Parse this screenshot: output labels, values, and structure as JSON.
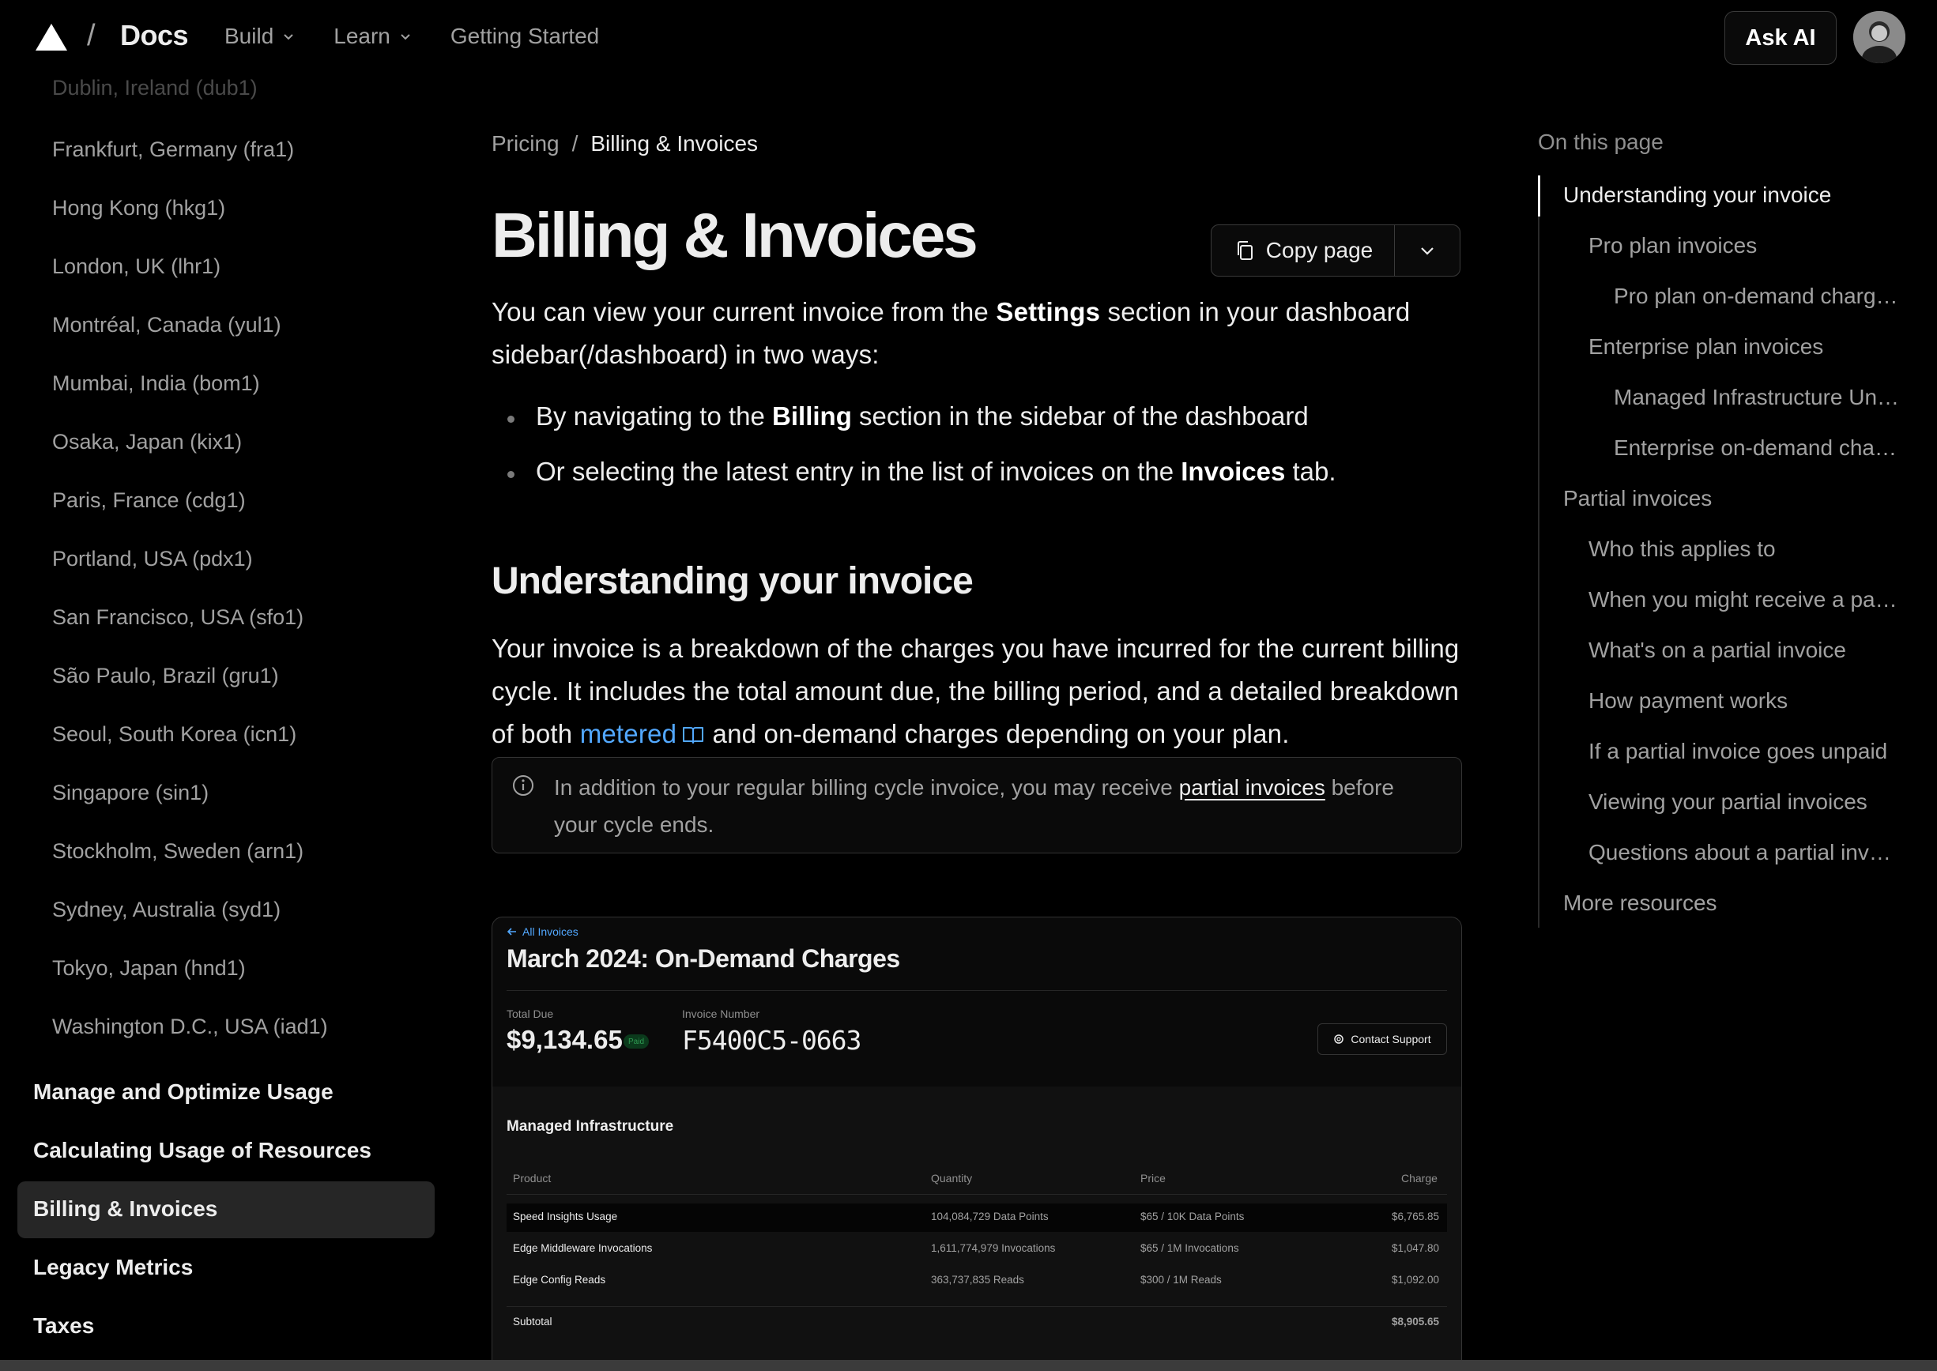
{
  "header": {
    "docs_title": "Docs",
    "separator": "/",
    "nav": [
      {
        "label": "Build",
        "has_menu": true
      },
      {
        "label": "Learn",
        "has_menu": true
      },
      {
        "label": "Getting Started",
        "has_menu": false
      }
    ],
    "ask_ai_label": "Ask AI"
  },
  "sidebar": {
    "regions": [
      "Dublin, Ireland (dub1)",
      "Frankfurt, Germany (fra1)",
      "Hong Kong (hkg1)",
      "London, UK (lhr1)",
      "Montréal, Canada (yul1)",
      "Mumbai, India (bom1)",
      "Osaka, Japan (kix1)",
      "Paris, France (cdg1)",
      "Portland, USA (pdx1)",
      "San Francisco, USA (sfo1)",
      "São Paulo, Brazil (gru1)",
      "Seoul, South Korea (icn1)",
      "Singapore (sin1)",
      "Stockholm, Sweden (arn1)",
      "Sydney, Australia (syd1)",
      "Tokyo, Japan (hnd1)",
      "Washington D.C., USA (iad1)"
    ],
    "sections": [
      "Manage and Optimize Usage",
      "Calculating Usage of Resources",
      "Billing & Invoices",
      "Legacy Metrics",
      "Taxes"
    ],
    "active_section": "Billing & Invoices"
  },
  "main": {
    "breadcrumb": {
      "parent": "Pricing",
      "separator": "/",
      "current": "Billing & Invoices"
    },
    "title": "Billing & Invoices",
    "copy_page_label": "Copy page",
    "intro": {
      "before": "You can view your current invoice from the ",
      "bold": "Settings",
      "after": " section in your dashboard sidebar(/dashboard) in two ways:"
    },
    "bullets": [
      {
        "before": "By navigating to the ",
        "bold": "Billing",
        "after": " section in the sidebar of the dashboard"
      },
      {
        "before": "Or selecting the latest entry in the list of invoices on the ",
        "bold": "Invoices",
        "after": " tab."
      }
    ],
    "section_heading": "Understanding your invoice",
    "paragraph": {
      "before": "Your invoice is a breakdown of the charges you have incurred for the current billing cycle. It includes the total amount due, the billing period, and a detailed breakdown of both ",
      "link": "metered",
      "after": " and on-demand charges depending on your plan."
    },
    "note": {
      "before": "In addition to your regular billing cycle invoice, you may receive ",
      "link": "partial invoices",
      "after": " before your cycle ends."
    },
    "invoice_image": {
      "back_label": "All Invoices",
      "title": "March 2024: On-Demand Charges",
      "total_due_label": "Total Due",
      "total_due": "$9,134.65",
      "status_badge": "Paid",
      "invoice_number_label": "Invoice Number",
      "invoice_number": "F5400C5-0663",
      "contact_support": "Contact Support",
      "section": "Managed Infrastructure",
      "columns": [
        "Product",
        "Quantity",
        "Price",
        "Charge"
      ],
      "rows": [
        {
          "product": "Speed Insights Usage",
          "quantity": "104,084,729 Data Points",
          "price": "$65 / 10K Data Points",
          "charge": "$6,765.85"
        },
        {
          "product": "Edge Middleware Invocations",
          "quantity": "1,611,774,979 Invocations",
          "price": "$65 / 1M Invocations",
          "charge": "$1,047.80"
        },
        {
          "product": "Edge Config Reads",
          "quantity": "363,737,835 Reads",
          "price": "$300 / 1M Reads",
          "charge": "$1,092.00"
        }
      ],
      "subtotal_label": "Subtotal",
      "subtotal": "$8,905.65"
    }
  },
  "toc": {
    "heading": "On this page",
    "items": [
      {
        "label": "Understanding your invoice",
        "level": 0,
        "active": true
      },
      {
        "label": "Pro plan invoices",
        "level": 1
      },
      {
        "label": "Pro plan on-demand charg…",
        "level": 2
      },
      {
        "label": "Enterprise plan invoices",
        "level": 1
      },
      {
        "label": "Managed Infrastructure Un…",
        "level": 2
      },
      {
        "label": "Enterprise on-demand cha…",
        "level": 2
      },
      {
        "label": "Partial invoices",
        "level": 0
      },
      {
        "label": "Who this applies to",
        "level": 1
      },
      {
        "label": "When you might receive a pa…",
        "level": 1
      },
      {
        "label": "What's on a partial invoice",
        "level": 1
      },
      {
        "label": "How payment works",
        "level": 1
      },
      {
        "label": "If a partial invoice goes unpaid",
        "level": 1
      },
      {
        "label": "Viewing your partial invoices",
        "level": 1
      },
      {
        "label": "Questions about a partial inv…",
        "level": 1
      },
      {
        "label": "More resources",
        "level": 0
      }
    ]
  },
  "colors": {
    "background": "#000000",
    "text": "#ededed",
    "muted": "#a1a1a1",
    "link": "#52a8ff",
    "active_bg": "#262626"
  }
}
